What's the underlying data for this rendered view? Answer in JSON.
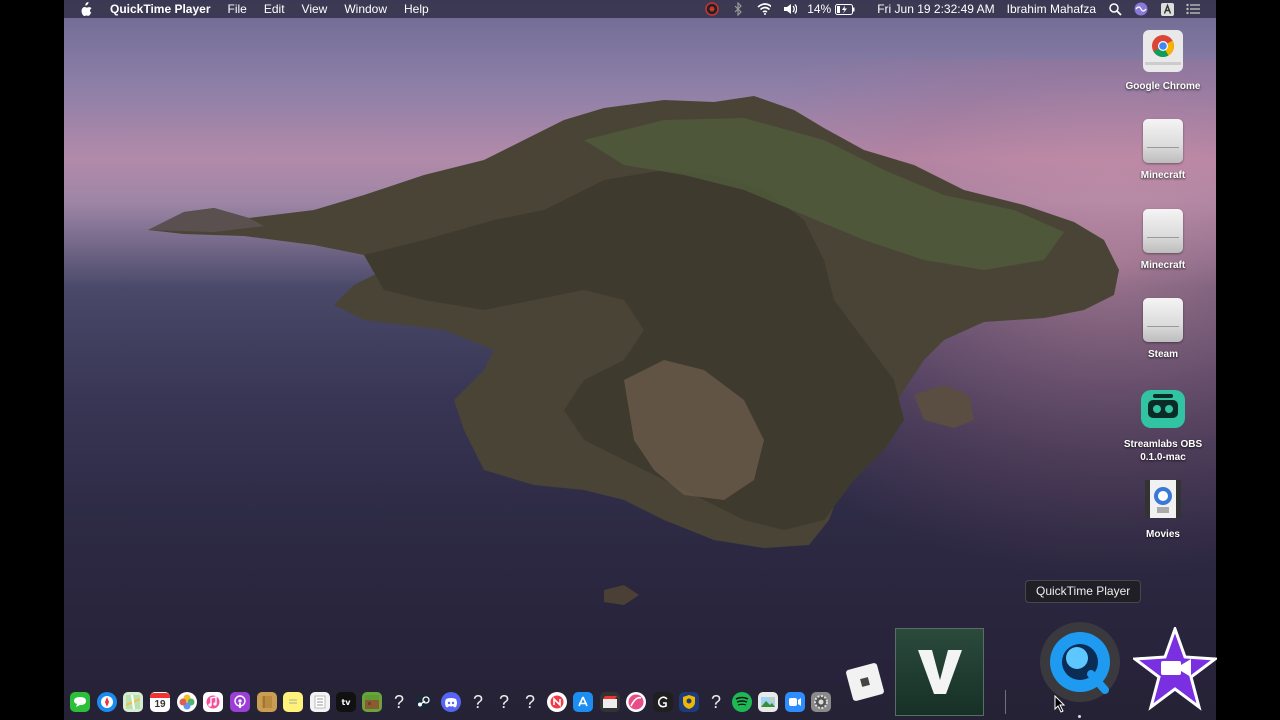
{
  "menubar": {
    "app_name": "QuickTime Player",
    "menus": [
      "File",
      "Edit",
      "View",
      "Window",
      "Help"
    ],
    "battery": "14%",
    "datetime": "Fri Jun 19  2:32:49 AM",
    "user": "Ibrahim Mahafza"
  },
  "desktop_icons": [
    {
      "label": "Google Chrome",
      "icon": "chrome-icon"
    },
    {
      "label": "Minecraft",
      "icon": "drive-icon"
    },
    {
      "label": "Minecraft",
      "icon": "drive-icon"
    },
    {
      "label": "Steam",
      "icon": "drive-icon"
    },
    {
      "label": "Streamlabs OBS\n0.1.0-mac",
      "line1": "Streamlabs OBS",
      "line2": "0.1.0-mac",
      "icon": "streamlabs-icon"
    },
    {
      "label": "Movies",
      "icon": "movies-icon"
    }
  ],
  "tooltip": "QuickTime Player",
  "calendar_day": "19",
  "dock_placeholder": "?",
  "colors": {
    "menubar_bg": "#28263a",
    "tooltip_bg": "#1e1e22",
    "accent_qt": "#1e9bf0",
    "imovie_purple": "#7a2fe0"
  }
}
